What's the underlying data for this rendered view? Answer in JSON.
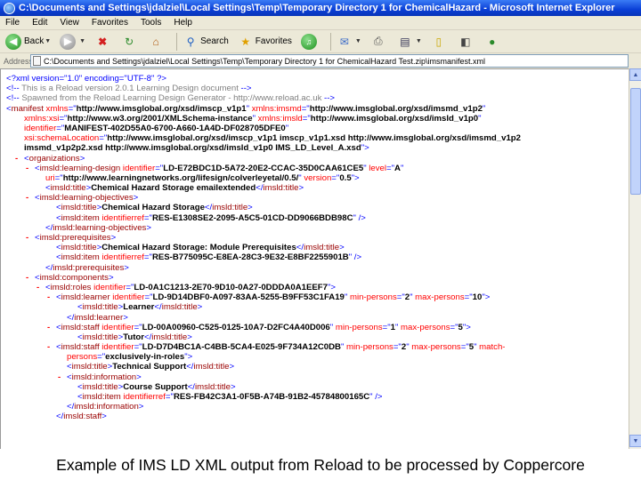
{
  "window": {
    "title": "C:\\Documents and Settings\\jdalziel\\Local Settings\\Temp\\Temporary Directory 1 for ChemicalHazard - Microsoft Internet Explorer"
  },
  "menu": [
    "File",
    "Edit",
    "View",
    "Favorites",
    "Tools",
    "Help"
  ],
  "toolbar": {
    "back_label": "Back",
    "search_label": "Search",
    "favorites_label": "Favorites"
  },
  "address": {
    "label": "Address",
    "value": "C:\\Documents and Settings\\jdalziel\\Local Settings\\Temp\\Temporary Directory 1 for ChemicalHazard Test.zip\\imsmanifest.xml"
  },
  "xml_lines": [
    {
      "indent": 6,
      "minus": false,
      "parts": [
        {
          "c": "blue",
          "t": "<?xml version=\"1.0\" encoding=\"UTF-8\" ?>"
        }
      ]
    },
    {
      "indent": 6,
      "minus": false,
      "parts": [
        {
          "c": "blue",
          "t": "<!-- "
        },
        {
          "c": "gray",
          "t": "This is a Reload version 2.0.1 Learning Design document"
        },
        {
          "c": "blue",
          "t": " -->"
        }
      ]
    },
    {
      "indent": 6,
      "minus": false,
      "parts": [
        {
          "c": "blue",
          "t": "<!-- "
        },
        {
          "c": "gray",
          "t": "Spawned from the Reload Learning Design Generator - http://www.reload.ac.uk"
        },
        {
          "c": "blue",
          "t": " -->"
        }
      ]
    },
    {
      "indent": 6,
      "minus": true,
      "parts": [
        {
          "c": "blue",
          "t": "<"
        },
        {
          "c": "maroon",
          "t": "manifest"
        },
        {
          "c": "red",
          "t": " xmlns"
        },
        {
          "c": "blue",
          "t": "=\""
        },
        {
          "c": "black",
          "t": "http://www.imsglobal.org/xsd/imscp_v1p1"
        },
        {
          "c": "blue",
          "t": "\""
        },
        {
          "c": "red",
          "t": " xmlns:imsmd"
        },
        {
          "c": "blue",
          "t": "=\""
        },
        {
          "c": "black",
          "t": "http://www.imsglobal.org/xsd/imsmd_v1p2"
        },
        {
          "c": "blue",
          "t": "\""
        }
      ]
    },
    {
      "indent": 26,
      "minus": false,
      "parts": [
        {
          "c": "red",
          "t": "xmlns:xsi"
        },
        {
          "c": "blue",
          "t": "=\""
        },
        {
          "c": "black",
          "t": "http://www.w3.org/2001/XMLSchema-instance"
        },
        {
          "c": "blue",
          "t": "\""
        },
        {
          "c": "red",
          "t": " xmlns:imsld"
        },
        {
          "c": "blue",
          "t": "=\""
        },
        {
          "c": "black",
          "t": "http://www.imsglobal.org/xsd/imsld_v1p0"
        },
        {
          "c": "blue",
          "t": "\""
        }
      ]
    },
    {
      "indent": 26,
      "minus": false,
      "parts": [
        {
          "c": "red",
          "t": "identifier"
        },
        {
          "c": "blue",
          "t": "=\""
        },
        {
          "c": "black",
          "t": "MANIFEST-402D55A0-6700-A660-1A4D-DF028705DFE0"
        },
        {
          "c": "blue",
          "t": "\""
        }
      ]
    },
    {
      "indent": 26,
      "minus": false,
      "parts": [
        {
          "c": "red",
          "t": "xsi:schemaLocation"
        },
        {
          "c": "blue",
          "t": "=\""
        },
        {
          "c": "black",
          "t": "http://www.imsglobal.org/xsd/imscp_v1p1 imscp_v1p1.xsd http://www.imsglobal.org/xsd/imsmd_v1p2"
        }
      ]
    },
    {
      "indent": 26,
      "minus": false,
      "parts": [
        {
          "c": "black",
          "t": "imsmd_v1p2p2.xsd http://www.imsglobal.org/xsd/imsld_v1p0 IMS_LD_Level_A.xsd"
        },
        {
          "c": "blue",
          "t": "\">"
        }
      ]
    },
    {
      "indent": 26,
      "minus": true,
      "parts": [
        {
          "c": "blue",
          "t": "<"
        },
        {
          "c": "maroon",
          "t": "organizations"
        },
        {
          "c": "blue",
          "t": ">"
        }
      ]
    },
    {
      "indent": 38,
      "minus": true,
      "parts": [
        {
          "c": "blue",
          "t": "<"
        },
        {
          "c": "maroon",
          "t": "imsld:learning-design"
        },
        {
          "c": "red",
          "t": " identifier"
        },
        {
          "c": "blue",
          "t": "=\""
        },
        {
          "c": "black",
          "t": "LD-E72BDC1D-5A72-20E2-CCAC-35D0CAA61CE5"
        },
        {
          "c": "blue",
          "t": "\""
        },
        {
          "c": "red",
          "t": " level"
        },
        {
          "c": "blue",
          "t": "=\""
        },
        {
          "c": "black",
          "t": "A"
        },
        {
          "c": "blue",
          "t": "\""
        }
      ]
    },
    {
      "indent": 50,
      "minus": false,
      "parts": [
        {
          "c": "red",
          "t": "uri"
        },
        {
          "c": "blue",
          "t": "=\""
        },
        {
          "c": "black",
          "t": "http://www.learningnetworks.org/lifesign/colverleyetal/0.5/"
        },
        {
          "c": "blue",
          "t": "\""
        },
        {
          "c": "red",
          "t": " version"
        },
        {
          "c": "blue",
          "t": "=\""
        },
        {
          "c": "black",
          "t": "0.5"
        },
        {
          "c": "blue",
          "t": "\">"
        }
      ]
    },
    {
      "indent": 50,
      "minus": false,
      "parts": [
        {
          "c": "blue",
          "t": "<"
        },
        {
          "c": "maroon",
          "t": "imsld:title"
        },
        {
          "c": "blue",
          "t": ">"
        },
        {
          "c": "black",
          "t": "Chemical Hazard Storage emailextended"
        },
        {
          "c": "blue",
          "t": "</"
        },
        {
          "c": "maroon",
          "t": "imsld:title"
        },
        {
          "c": "blue",
          "t": ">"
        }
      ]
    },
    {
      "indent": 38,
      "minus": true,
      "parts": [
        {
          "c": "blue",
          "t": "<"
        },
        {
          "c": "maroon",
          "t": "imsld:learning-objectives"
        },
        {
          "c": "blue",
          "t": ">"
        }
      ]
    },
    {
      "indent": 62,
      "minus": false,
      "parts": [
        {
          "c": "blue",
          "t": "<"
        },
        {
          "c": "maroon",
          "t": "imsld:title"
        },
        {
          "c": "blue",
          "t": ">"
        },
        {
          "c": "black",
          "t": "Chemical Hazard Storage"
        },
        {
          "c": "blue",
          "t": "</"
        },
        {
          "c": "maroon",
          "t": "imsld:title"
        },
        {
          "c": "blue",
          "t": ">"
        }
      ]
    },
    {
      "indent": 62,
      "minus": false,
      "parts": [
        {
          "c": "blue",
          "t": "<"
        },
        {
          "c": "maroon",
          "t": "imsld:item"
        },
        {
          "c": "red",
          "t": " identifierref"
        },
        {
          "c": "blue",
          "t": "=\""
        },
        {
          "c": "black",
          "t": "RES-E1308SE2-2095-A5C5-01CD-DD9066BDB98C"
        },
        {
          "c": "blue",
          "t": "\" />"
        }
      ]
    },
    {
      "indent": 50,
      "minus": false,
      "parts": [
        {
          "c": "blue",
          "t": "</"
        },
        {
          "c": "maroon",
          "t": "imsld:learning-objectives"
        },
        {
          "c": "blue",
          "t": ">"
        }
      ]
    },
    {
      "indent": 38,
      "minus": true,
      "parts": [
        {
          "c": "blue",
          "t": "<"
        },
        {
          "c": "maroon",
          "t": "imsld:prerequisites"
        },
        {
          "c": "blue",
          "t": ">"
        }
      ]
    },
    {
      "indent": 62,
      "minus": false,
      "parts": [
        {
          "c": "blue",
          "t": "<"
        },
        {
          "c": "maroon",
          "t": "imsld:title"
        },
        {
          "c": "blue",
          "t": ">"
        },
        {
          "c": "black",
          "t": "Chemical Hazard Storage: Module Prerequisites"
        },
        {
          "c": "blue",
          "t": "</"
        },
        {
          "c": "maroon",
          "t": "imsld:title"
        },
        {
          "c": "blue",
          "t": ">"
        }
      ]
    },
    {
      "indent": 62,
      "minus": false,
      "parts": [
        {
          "c": "blue",
          "t": "<"
        },
        {
          "c": "maroon",
          "t": "imsld:item"
        },
        {
          "c": "red",
          "t": " identifierref"
        },
        {
          "c": "blue",
          "t": "=\""
        },
        {
          "c": "black",
          "t": "RES-B775095C-E8EA-28C3-9E32-E8BF2255901B"
        },
        {
          "c": "blue",
          "t": "\" />"
        }
      ]
    },
    {
      "indent": 50,
      "minus": false,
      "parts": [
        {
          "c": "blue",
          "t": "</"
        },
        {
          "c": "maroon",
          "t": "imsld:prerequisites"
        },
        {
          "c": "blue",
          "t": ">"
        }
      ]
    },
    {
      "indent": 38,
      "minus": true,
      "parts": [
        {
          "c": "blue",
          "t": "<"
        },
        {
          "c": "maroon",
          "t": "imsld:components"
        },
        {
          "c": "blue",
          "t": ">"
        }
      ]
    },
    {
      "indent": 50,
      "minus": true,
      "parts": [
        {
          "c": "blue",
          "t": "<"
        },
        {
          "c": "maroon",
          "t": "imsld:roles"
        },
        {
          "c": "red",
          "t": " identifier"
        },
        {
          "c": "blue",
          "t": "=\""
        },
        {
          "c": "black",
          "t": "LD-0A1C1213-2E70-9D10-0A27-0DDDA0A1EEF7"
        },
        {
          "c": "blue",
          "t": "\">"
        }
      ]
    },
    {
      "indent": 62,
      "minus": true,
      "parts": [
        {
          "c": "blue",
          "t": "<"
        },
        {
          "c": "maroon",
          "t": "imsld:learner"
        },
        {
          "c": "red",
          "t": " identifier"
        },
        {
          "c": "blue",
          "t": "=\""
        },
        {
          "c": "black",
          "t": "LD-9D14DBF0-A097-83AA-5255-B9FF53C1FA19"
        },
        {
          "c": "blue",
          "t": "\""
        },
        {
          "c": "red",
          "t": " min-persons"
        },
        {
          "c": "blue",
          "t": "=\""
        },
        {
          "c": "black",
          "t": "2"
        },
        {
          "c": "blue",
          "t": "\""
        },
        {
          "c": "red",
          "t": " max-persons"
        },
        {
          "c": "blue",
          "t": "=\""
        },
        {
          "c": "black",
          "t": "10"
        },
        {
          "c": "blue",
          "t": "\">"
        }
      ]
    },
    {
      "indent": 86,
      "minus": false,
      "parts": [
        {
          "c": "blue",
          "t": "<"
        },
        {
          "c": "maroon",
          "t": "imsld:title"
        },
        {
          "c": "blue",
          "t": ">"
        },
        {
          "c": "black",
          "t": "Learner"
        },
        {
          "c": "blue",
          "t": "</"
        },
        {
          "c": "maroon",
          "t": "imsld:title"
        },
        {
          "c": "blue",
          "t": ">"
        }
      ]
    },
    {
      "indent": 74,
      "minus": false,
      "parts": [
        {
          "c": "blue",
          "t": "</"
        },
        {
          "c": "maroon",
          "t": "imsld:learner"
        },
        {
          "c": "blue",
          "t": ">"
        }
      ]
    },
    {
      "indent": 62,
      "minus": true,
      "parts": [
        {
          "c": "blue",
          "t": "<"
        },
        {
          "c": "maroon",
          "t": "imsld:staff"
        },
        {
          "c": "red",
          "t": " identifier"
        },
        {
          "c": "blue",
          "t": "=\""
        },
        {
          "c": "black",
          "t": "LD-00A00960-C525-0125-10A7-D2FC4A40D006"
        },
        {
          "c": "blue",
          "t": "\""
        },
        {
          "c": "red",
          "t": " min-persons"
        },
        {
          "c": "blue",
          "t": "=\""
        },
        {
          "c": "black",
          "t": "1"
        },
        {
          "c": "blue",
          "t": "\""
        },
        {
          "c": "red",
          "t": " max-persons"
        },
        {
          "c": "blue",
          "t": "=\""
        },
        {
          "c": "black",
          "t": "5"
        },
        {
          "c": "blue",
          "t": "\">"
        }
      ]
    },
    {
      "indent": 86,
      "minus": false,
      "parts": [
        {
          "c": "blue",
          "t": "<"
        },
        {
          "c": "maroon",
          "t": "imsld:title"
        },
        {
          "c": "blue",
          "t": ">"
        },
        {
          "c": "black",
          "t": "Tutor"
        },
        {
          "c": "blue",
          "t": "</"
        },
        {
          "c": "maroon",
          "t": "imsld:title"
        },
        {
          "c": "blue",
          "t": ">"
        }
      ]
    },
    {
      "indent": 62,
      "minus": true,
      "parts": [
        {
          "c": "blue",
          "t": "<"
        },
        {
          "c": "maroon",
          "t": "imsld:staff"
        },
        {
          "c": "red",
          "t": " identifier"
        },
        {
          "c": "blue",
          "t": "=\""
        },
        {
          "c": "black",
          "t": "LD-D7D4BC1A-C4BB-5CA4-E025-9F734A12C0DB"
        },
        {
          "c": "blue",
          "t": "\""
        },
        {
          "c": "red",
          "t": " min-persons"
        },
        {
          "c": "blue",
          "t": "=\""
        },
        {
          "c": "black",
          "t": "2"
        },
        {
          "c": "blue",
          "t": "\""
        },
        {
          "c": "red",
          "t": " max-persons"
        },
        {
          "c": "blue",
          "t": "=\""
        },
        {
          "c": "black",
          "t": "5"
        },
        {
          "c": "blue",
          "t": "\""
        },
        {
          "c": "red",
          "t": " match-"
        }
      ]
    },
    {
      "indent": 74,
      "minus": false,
      "parts": [
        {
          "c": "red",
          "t": "persons"
        },
        {
          "c": "blue",
          "t": "=\""
        },
        {
          "c": "black",
          "t": "exclusively-in-roles"
        },
        {
          "c": "blue",
          "t": "\">"
        }
      ]
    },
    {
      "indent": 74,
      "minus": false,
      "parts": [
        {
          "c": "blue",
          "t": "<"
        },
        {
          "c": "maroon",
          "t": "imsld:title"
        },
        {
          "c": "blue",
          "t": ">"
        },
        {
          "c": "black",
          "t": "Technical Support"
        },
        {
          "c": "blue",
          "t": "</"
        },
        {
          "c": "maroon",
          "t": "imsld:title"
        },
        {
          "c": "blue",
          "t": ">"
        }
      ]
    },
    {
      "indent": 74,
      "minus": true,
      "parts": [
        {
          "c": "blue",
          "t": "<"
        },
        {
          "c": "maroon",
          "t": "imsld:information"
        },
        {
          "c": "blue",
          "t": ">"
        }
      ]
    },
    {
      "indent": 86,
      "minus": false,
      "parts": [
        {
          "c": "blue",
          "t": "<"
        },
        {
          "c": "maroon",
          "t": "imsld:title"
        },
        {
          "c": "blue",
          "t": ">"
        },
        {
          "c": "black",
          "t": "Course Support"
        },
        {
          "c": "blue",
          "t": "</"
        },
        {
          "c": "maroon",
          "t": "imsld:title"
        },
        {
          "c": "blue",
          "t": ">"
        }
      ]
    },
    {
      "indent": 86,
      "minus": false,
      "parts": [
        {
          "c": "blue",
          "t": "<"
        },
        {
          "c": "maroon",
          "t": "imsld:item"
        },
        {
          "c": "red",
          "t": " identifierref"
        },
        {
          "c": "blue",
          "t": "=\""
        },
        {
          "c": "black",
          "t": "RES-FB42C3A1-0F5B-A74B-91B2-45784800165C"
        },
        {
          "c": "blue",
          "t": "\" />"
        }
      ]
    },
    {
      "indent": 74,
      "minus": false,
      "parts": [
        {
          "c": "blue",
          "t": "</"
        },
        {
          "c": "maroon",
          "t": "imsld:information"
        },
        {
          "c": "blue",
          "t": ">"
        }
      ]
    },
    {
      "indent": 62,
      "minus": false,
      "parts": [
        {
          "c": "blue",
          "t": "</"
        },
        {
          "c": "maroon",
          "t": "imsld:staff"
        },
        {
          "c": "blue",
          "t": ">"
        }
      ]
    }
  ],
  "caption": "Example of IMS LD XML output from Reload to be processed by Coppercore"
}
